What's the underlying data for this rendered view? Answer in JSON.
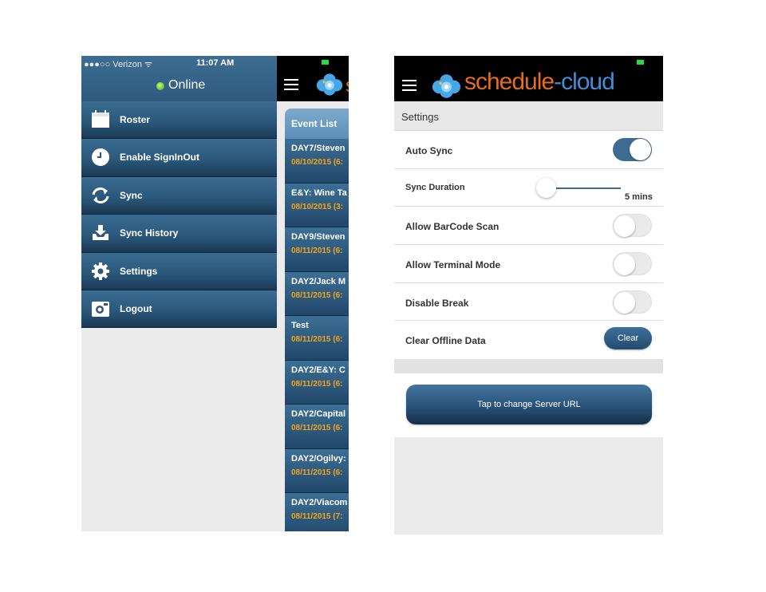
{
  "left_screen": {
    "status_bar": {
      "carrier": "●●●○○ Verizon ᯤ",
      "time": "11:07 AM"
    },
    "connection_status": "Online",
    "menu": [
      {
        "label": "Roster",
        "icon": "calendar-icon"
      },
      {
        "label": "Enable SignInOut",
        "icon": "clock-icon"
      },
      {
        "label": "Sync",
        "icon": "sync-icon"
      },
      {
        "label": "Sync History",
        "icon": "download-tray-icon"
      },
      {
        "label": "Settings",
        "icon": "gear-icon"
      },
      {
        "label": "Logout",
        "icon": "camera-icon"
      }
    ],
    "event_panel": {
      "brand_fragment": "s",
      "header": "Event List",
      "events": [
        {
          "title": "DAY7/Steven",
          "date": "08/10/2015 (6:"
        },
        {
          "title": "E&Y: Wine Ta",
          "date": "08/10/2015 (3:"
        },
        {
          "title": "DAY9/Steven",
          "date": "08/11/2015 (6:"
        },
        {
          "title": "DAY2/Jack M",
          "date": "08/11/2015 (6:"
        },
        {
          "title": "Test",
          "date": "08/11/2015 (6:"
        },
        {
          "title": "DAY2/E&Y: C",
          "date": "08/11/2015 (6:"
        },
        {
          "title": "DAY2/Capital",
          "date": "08/11/2015 (6:"
        },
        {
          "title": "DAY2/Ogilvy:",
          "date": "08/11/2015 (6:"
        },
        {
          "title": "DAY2/Viacom",
          "date": "08/11/2015 (7:"
        }
      ]
    }
  },
  "right_screen": {
    "brand": {
      "part1": "schedule",
      "part2": "-cloud"
    },
    "section_title": "Settings",
    "settings": {
      "auto_sync": {
        "label": "Auto Sync",
        "enabled": true
      },
      "sync_duration": {
        "label": "Sync Duration",
        "value": "5 mins",
        "slider_level": 0
      },
      "allow_barcode_scan": {
        "label": "Allow BarCode Scan",
        "enabled": false
      },
      "allow_terminal_mode": {
        "label": "Allow Terminal Mode",
        "enabled": false
      },
      "disable_break": {
        "label": "Disable Break",
        "enabled": false
      },
      "clear_offline_data": {
        "label": "Clear Offline Data",
        "button_label": "Clear"
      }
    },
    "server_button_label": "Tap to change Server URL"
  },
  "colors": {
    "nav_blue": "#2b587b",
    "toggle_on": "#3e6c93",
    "date_orange": "#f2a51c",
    "brand_orange": "#e76c1b",
    "brand_blue": "#3d8fd9",
    "online_green": "#35a51a"
  }
}
